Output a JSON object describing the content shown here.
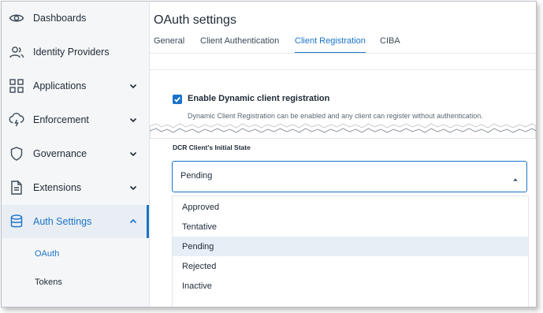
{
  "sidebar": {
    "items": [
      {
        "label": "Dashboards",
        "icon": "eye-icon"
      },
      {
        "label": "Identity Providers",
        "icon": "users-icon"
      },
      {
        "label": "Applications",
        "icon": "grid-icon"
      },
      {
        "label": "Enforcement",
        "icon": "cloud-lightning-icon"
      },
      {
        "label": "Governance",
        "icon": "shield-icon"
      },
      {
        "label": "Extensions",
        "icon": "document-icon"
      },
      {
        "label": "Auth Settings",
        "icon": "database-icon"
      }
    ],
    "sub_items": [
      {
        "label": "OAuth"
      },
      {
        "label": "Tokens"
      }
    ]
  },
  "main": {
    "title": "OAuth settings",
    "tabs": [
      {
        "label": "General"
      },
      {
        "label": "Client Authentication"
      },
      {
        "label": "Client Registration"
      },
      {
        "label": "CIBA"
      }
    ],
    "dcr": {
      "checkbox_label": "Enable Dynamic client registration",
      "help_text": "Dynamic Client Registration can be enabled and any client can register without authentication.",
      "field_label": "DCR Client's Initial State",
      "selected_value": "Pending",
      "options": [
        "Approved",
        "Tentative",
        "Pending",
        "Rejected",
        "Inactive"
      ]
    }
  },
  "colors": {
    "accent": "#1a73c8",
    "sidebar_bg": "#f5f6f7",
    "option_hover_bg": "#e8eef5"
  }
}
